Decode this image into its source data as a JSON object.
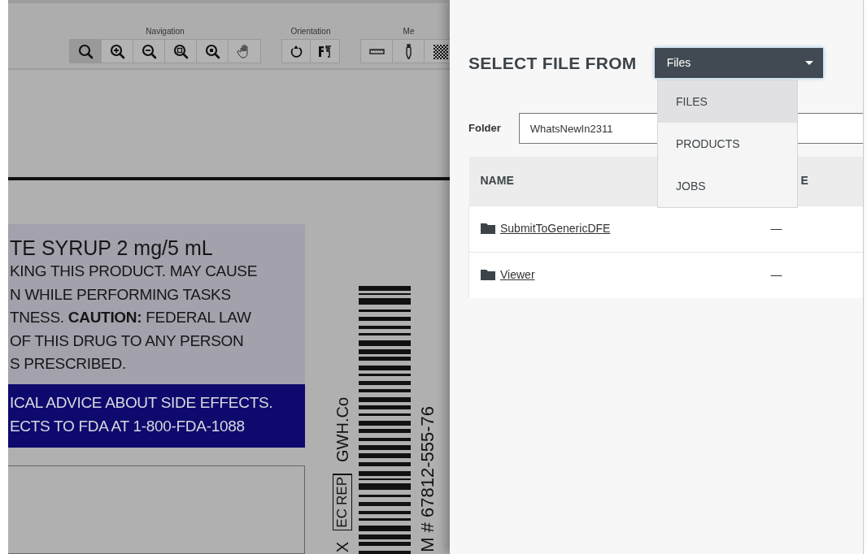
{
  "viewer": {
    "toolbar": {
      "groups": [
        {
          "label": "Navigation",
          "tools": [
            {
              "kind": "zoom",
              "selected": true
            },
            {
              "kind": "zoom-in",
              "selected": false
            },
            {
              "kind": "zoom-out",
              "selected": false
            },
            {
              "kind": "zoom-fit",
              "selected": false
            },
            {
              "kind": "zoom-area",
              "selected": false
            },
            {
              "kind": "pan",
              "selected": false
            }
          ]
        },
        {
          "label": "Orientation",
          "tools": [
            {
              "kind": "rotate",
              "selected": false
            },
            {
              "kind": "flip",
              "selected": false
            }
          ]
        },
        {
          "label": "Me",
          "tools": [
            {
              "kind": "ruler",
              "selected": false
            },
            {
              "kind": "dropper",
              "selected": false
            },
            {
              "kind": "checker",
              "selected": false
            }
          ]
        }
      ]
    },
    "document": {
      "heading": "TE SYRUP 2 mg/5 mL",
      "lines": [
        "KING THIS PRODUCT. MAY CAUSE",
        "N WHILE PERFORMING TASKS",
        "TNESS. **CAUTION:** FEDERAL LAW",
        "OF THIS DRUG TO ANY PERSON",
        "S PRESCRIBED."
      ],
      "warning_lines": [
        "ICAL ADVICE ABOUT SIDE EFFECTS.",
        "ECTS TO FDA AT 1-800-FDA-1088"
      ],
      "company": "GWH.Co",
      "ec_rep": [
        "EC",
        "REP"
      ],
      "code_fragment": "X",
      "item_number": "M # 67812-555-76"
    }
  },
  "panel": {
    "title": "SELECT FILE FROM",
    "source": {
      "value": "Files",
      "expanded": true,
      "options": [
        {
          "label": "FILES",
          "selected": true
        },
        {
          "label": "PRODUCTS",
          "selected": false
        },
        {
          "label": "JOBS",
          "selected": false
        }
      ]
    },
    "folder": {
      "label": "Folder",
      "value": "WhatsNewIn2311"
    },
    "table": {
      "columns": [
        "NAME",
        "E"
      ],
      "rows": [
        {
          "name": "SubmitToGenericDFE",
          "column_2": "—"
        },
        {
          "name": "Viewer",
          "column_2": "—"
        }
      ]
    }
  }
}
